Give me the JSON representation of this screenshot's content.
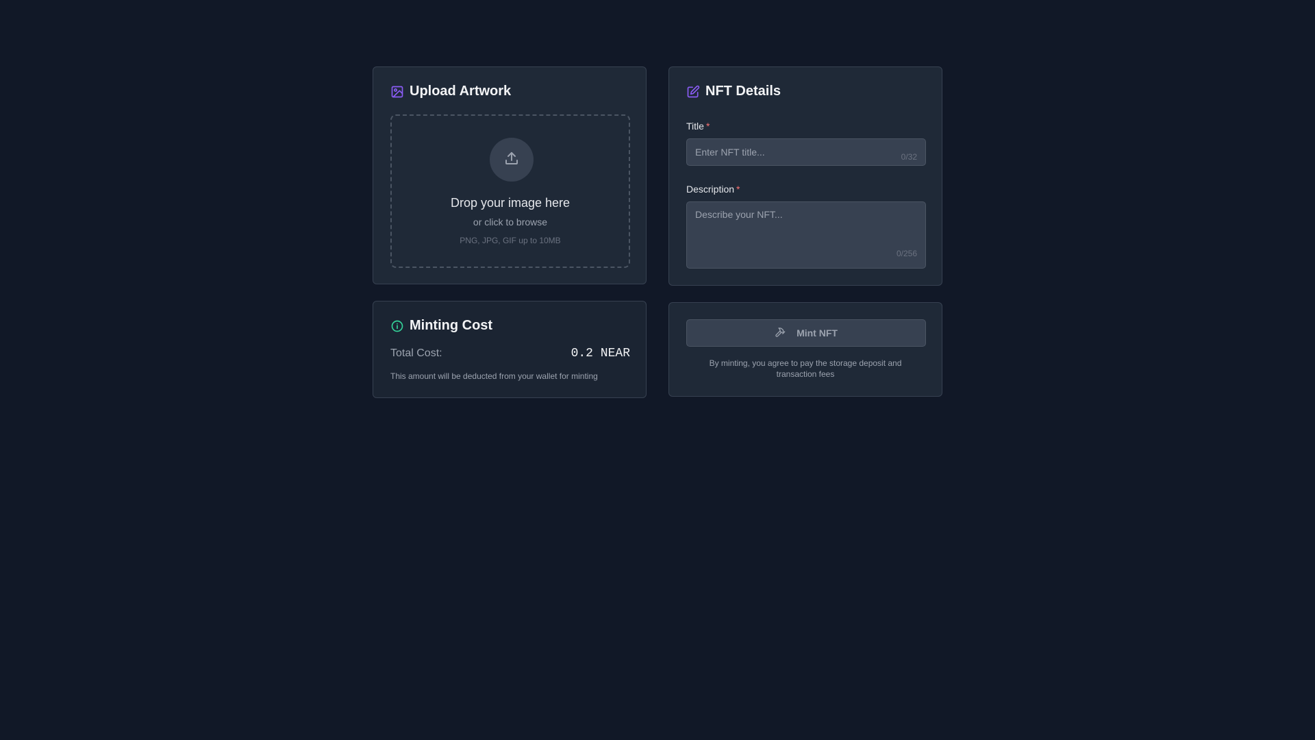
{
  "upload": {
    "title": "Upload Artwork",
    "header_icon": "image-icon",
    "dropzone_icon": "upload-icon",
    "dropzone_title": "Drop your image here",
    "dropzone_subtitle": "or click to browse",
    "dropzone_hint": "PNG, JPG, GIF up to 10MB"
  },
  "details": {
    "title": "NFT Details",
    "header_icon": "edit-icon",
    "title_label": "Title",
    "title_placeholder": "Enter NFT title...",
    "title_value": "",
    "title_counter": "0/32",
    "description_label": "Description",
    "description_placeholder": "Describe your NFT...",
    "description_value": "",
    "description_counter": "0/256",
    "required_marker": "*"
  },
  "cost": {
    "title": "Minting Cost",
    "header_icon": "info-icon",
    "total_label": "Total Cost:",
    "total_value": "0.2 NEAR",
    "note": "This amount will be deducted from your wallet for minting"
  },
  "mint": {
    "button_label": "Mint NFT",
    "button_icon": "hammer-icon",
    "disabled": true,
    "note": "By minting, you agree to pay the storage deposit and transaction fees"
  },
  "colors": {
    "background": "#111827",
    "card": "#1f2937",
    "accent_purple": "#8b5cf6",
    "accent_green": "#34d399",
    "required_red": "#f87171"
  }
}
